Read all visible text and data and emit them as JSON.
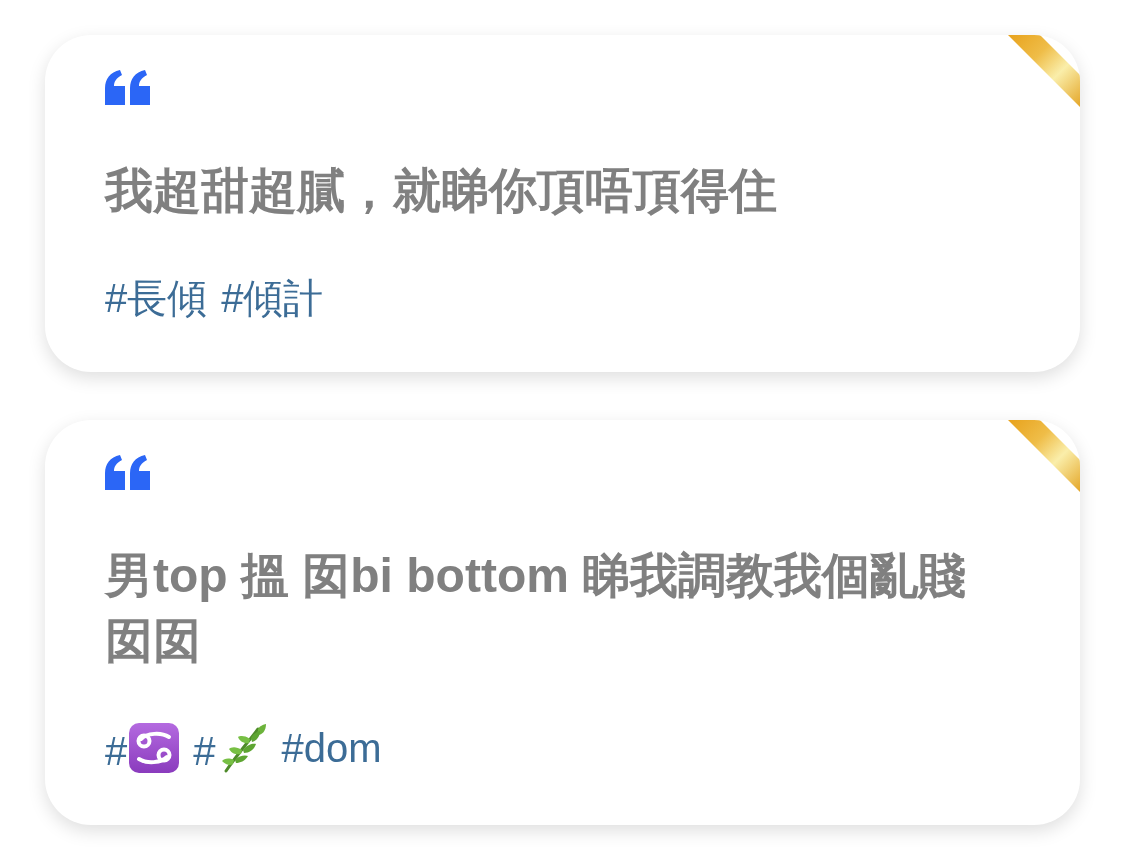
{
  "cards": [
    {
      "text": "我超甜超膩，就睇你頂唔頂得住",
      "tags": [
        {
          "kind": "text",
          "label": "#長傾"
        },
        {
          "kind": "text",
          "label": "#傾計"
        }
      ]
    },
    {
      "text": "男top 搵 囡bi bottom 睇我調教我個亂賤囡囡",
      "tags": [
        {
          "kind": "zodiac",
          "label": "#"
        },
        {
          "kind": "plant",
          "label": "#"
        },
        {
          "kind": "text",
          "label": "#dom"
        }
      ]
    }
  ]
}
